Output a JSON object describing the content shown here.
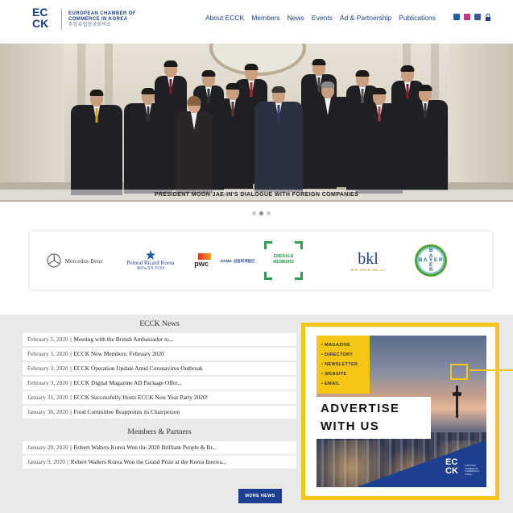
{
  "header": {
    "logo_ec": "EC",
    "logo_ck": "CK",
    "logo_line1": "EUROPEAN CHAMBER OF",
    "logo_line2": "COMMERCE IN KOREA",
    "logo_korean": "주한유럽상공회의소",
    "nav": [
      "About ECCK",
      "Members",
      "News",
      "Events",
      "Ad & Partnership",
      "Publications"
    ],
    "social_icons": [
      "linkedin-icon",
      "instagram-icon",
      "facebook-icon",
      "lock-icon"
    ],
    "social_colors": [
      "#1c5fa8",
      "#c13584",
      "#3b5998",
      "#666666"
    ]
  },
  "hero": {
    "caption": "PRESIDENT MOON JAE-IN'S DIALOGUE WITH FOREIGN COMPANIES",
    "slides": 3,
    "active_slide": 2
  },
  "partners": {
    "mercedes": "Mercedes-Benz",
    "pernod": "Pernod Ricard Korea",
    "pernod_sub": "페르노리카 코리아",
    "pwc": "pwc",
    "samil": "SAMIL 삼일회계법인",
    "emerald": "EMERALD MEMBERS",
    "bkl": "bkl",
    "bkl_sub": "BAE, KIM & LEE LLC",
    "bayer_b": "B",
    "bayer_a": "A",
    "bayer_y": "Y",
    "bayer_e": "E",
    "bayer_r": "R"
  },
  "news": {
    "title": "ECCK News",
    "items": [
      {
        "date": "February 5, 2020",
        "title": "Meeting with the British Ambassador to..."
      },
      {
        "date": "February 5, 2020",
        "title": "ECCK New Members: February 2020"
      },
      {
        "date": "February 3, 2020",
        "title": "ECCK Operation Update Amid Coronavirus Outbreak"
      },
      {
        "date": "February 3, 2020",
        "title": "ECCK Digital Magazine AD Package Offer..."
      },
      {
        "date": "January 31, 2020",
        "title": "ECCK Successfully Hosts ECCK New Year Party 2020!"
      },
      {
        "date": "January 30, 2020",
        "title": "Food Committee Reappoints its Chairperson"
      }
    ],
    "partners_title": "Members & Partners",
    "partner_items": [
      {
        "date": "January 28, 2020",
        "title": "Robert Walters Korea Won the 2020 Brilliant People & Br..."
      },
      {
        "date": "January 9, 2020",
        "title": "Robert Walters Korea Won the Grand Prize at the Korea Innova..."
      }
    ],
    "separator": "||",
    "more_label": "MORE NEWS"
  },
  "ad": {
    "menu": [
      "• MAGAZINE",
      "• DIRECTORY",
      "• NEWSLETTER",
      "• WEBSITE",
      "• EMAIL"
    ],
    "line1": "ADVERTISE",
    "line2": "WITH US",
    "logo_ec": "EC",
    "logo_ck": "CK",
    "logo_small": "EUROPEAN CHAMBER OF COMMERCE IN KOREA",
    "frame_color": "#f5c518"
  }
}
